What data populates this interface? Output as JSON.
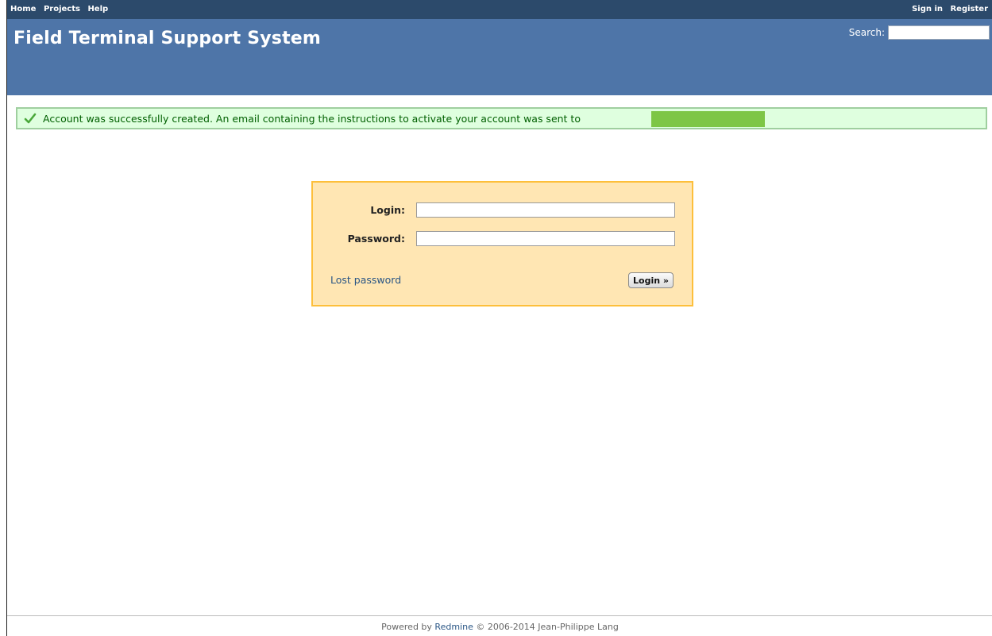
{
  "top_menu": {
    "left_items": [
      "Home",
      "Projects",
      "Help"
    ],
    "right_items": [
      "Sign in",
      "Register"
    ]
  },
  "header": {
    "title": "Field Terminal Support System",
    "search_label": "Search:",
    "search_value": ""
  },
  "flash": {
    "icon": "checkmark-icon",
    "message": "Account was successfully created. An email containing the instructions to activate your account was sent to",
    "redaction_color": "#7dc646"
  },
  "login_form": {
    "login_label": "Login:",
    "login_value": "",
    "password_label": "Password:",
    "password_value": "",
    "lost_password": "Lost password",
    "submit_label": "Login »"
  },
  "footer": {
    "prefix": "Powered by",
    "link": "Redmine",
    "suffix": "© 2006-2014 Jean-Philippe Lang"
  },
  "colors": {
    "top_menu_bg": "#2c4a6b",
    "header_bg": "#4e75a8",
    "flash_bg": "#dfffdf",
    "flash_border": "#9fcf9f",
    "login_bg": "#ffe6b3",
    "login_border": "#fdbf3b",
    "link": "#2a5685"
  }
}
